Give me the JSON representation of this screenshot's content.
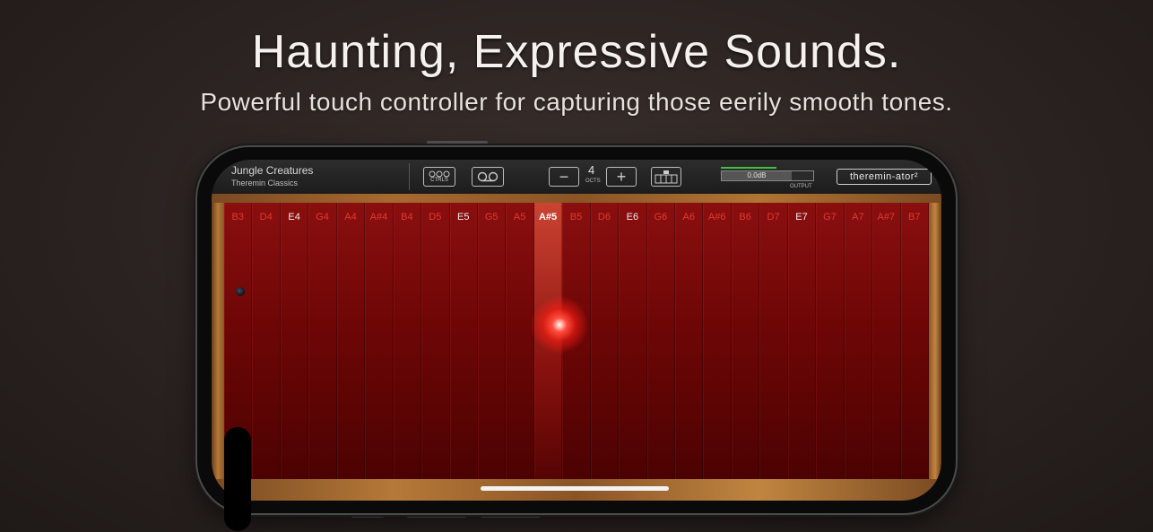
{
  "headline": "Haunting, Expressive Sounds.",
  "subheadline": "Powerful touch controller for capturing those eerily smooth tones.",
  "app": {
    "preset_name": "Jungle Creatures",
    "preset_bank": "Theremin Classics",
    "controls_label": "CTRLS",
    "octaves_value": "4",
    "octaves_label": "OCTS",
    "minus_label": "−",
    "plus_label": "+",
    "output_level": "0.0dB",
    "output_label": "OUTPUT",
    "logo": "theremin-ator²"
  },
  "notes": [
    "B3",
    "D4",
    "E4",
    "G4",
    "A4",
    "A#4",
    "B4",
    "D5",
    "E5",
    "G5",
    "A5",
    "A#5",
    "B5",
    "D6",
    "E6",
    "G6",
    "A6",
    "A#6",
    "B6",
    "D7",
    "E7",
    "G7",
    "A7",
    "A#7",
    "B7"
  ],
  "active_note": "A#5",
  "colors": {
    "accent_red": "#e03a33",
    "meter_green": "#3fbf3f",
    "board_red": "#7a0808"
  }
}
